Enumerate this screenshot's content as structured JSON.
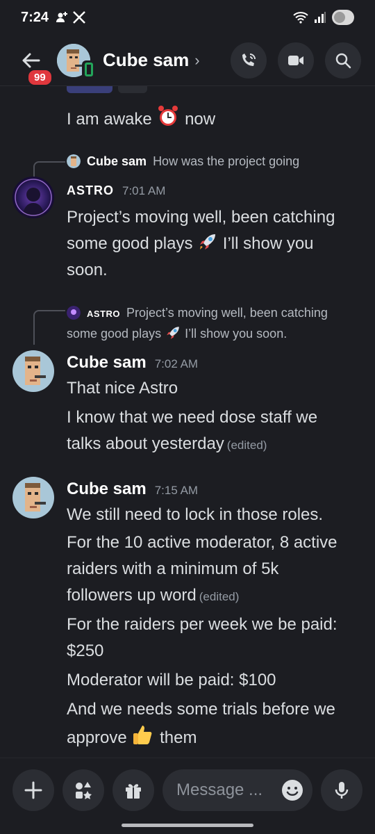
{
  "status_bar": {
    "time": "7:24",
    "left_icons": [
      "person-add-icon",
      "x-logo-icon"
    ],
    "right_icons": [
      "wifi-icon",
      "signal-icon",
      "battery-toggle-icon"
    ]
  },
  "header": {
    "unread_badge": "99",
    "title": "Cube sam",
    "chevron": "›",
    "actions": [
      "phone-call-icon",
      "video-camera-icon",
      "search-icon"
    ]
  },
  "messages": [
    {
      "id": "m0",
      "continuation": true,
      "text_before": "I am awake",
      "emoji": "alarm-clock",
      "text_after": "now"
    },
    {
      "id": "m1",
      "reply_to": {
        "author": "Cube sam",
        "text": "How was the project going"
      },
      "author": "ASTRO",
      "time": "7:01 AM",
      "lines": [
        "Project’s moving well, been catching",
        "some good plays",
        "I’ll show you",
        "soon."
      ],
      "emoji": "rocket"
    },
    {
      "id": "m2",
      "reply_to": {
        "author": "ASTRO",
        "text_line1": "Project’s moving well, been catching",
        "text_line2_a": "some good plays",
        "text_line2_b": "I’ll show you soon."
      },
      "author": "Cube sam",
      "time": "7:02 AM",
      "line1": "That nice Astro",
      "line2": "I know that we need dose staff we",
      "line3": "talks about yesterday",
      "edited": "(edited)"
    },
    {
      "id": "m3",
      "author": "Cube sam",
      "time": "7:15 AM",
      "l1": "We still need to lock in those roles.",
      "l2": "For the 10 active moderator, 8 active",
      "l3": "raiders with a minimum of 5k",
      "l4": "followers up word",
      "edited": "(edited)",
      "l5": "For the raiders per week we be paid:",
      "l6": "$250",
      "l7": "Moderator will be paid: $100",
      "l8": "And we needs some trials before we",
      "l9a": "approve",
      "emoji": "thumbs-up",
      "l9b": "them"
    }
  ],
  "composer": {
    "buttons": [
      "plus-icon",
      "apps-icon",
      "gift-icon"
    ],
    "placeholder": "Message ...",
    "right_icons": [
      "emoji-icon",
      "microphone-icon"
    ]
  },
  "colors": {
    "background": "#1c1d22",
    "button_bg": "#2b2d33",
    "badge_red": "#e0373d",
    "online_green": "#23a55a"
  }
}
